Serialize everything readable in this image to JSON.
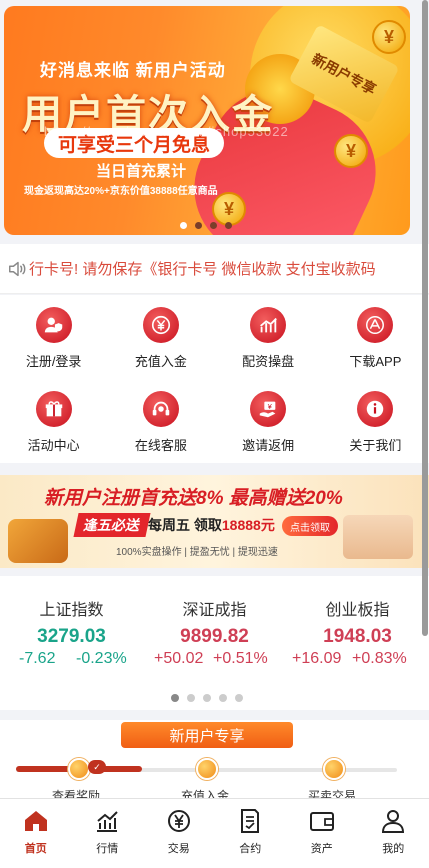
{
  "banner": {
    "subtitle": "好消息来临  新用户活动",
    "title": "用户首次入金",
    "pill": "可享受三个月免息",
    "first_recharge": "当日首充累计",
    "note": "现金返现高达20%+京东价值38888任意商品",
    "tag": "新用户专享",
    "coin_symbol": "¥",
    "watermark": "https://www.huzhan.com/ishop53022",
    "dot_count": 4,
    "active_dot": 0
  },
  "notice": {
    "text": "行卡号! 请勿保存《银行卡号  微信收款  支付宝收款码"
  },
  "menu": {
    "items": [
      {
        "label": "注册/登录",
        "icon": "user-shield-icon"
      },
      {
        "label": "充值入金",
        "icon": "yen-icon"
      },
      {
        "label": "配资操盘",
        "icon": "bar-chart-icon"
      },
      {
        "label": "下载APP",
        "icon": "app-store-icon"
      },
      {
        "label": "活动中心",
        "icon": "gift-icon"
      },
      {
        "label": "在线客服",
        "icon": "headset-icon"
      },
      {
        "label": "邀请返佣",
        "icon": "money-hand-icon"
      },
      {
        "label": "关于我们",
        "icon": "info-icon"
      }
    ]
  },
  "promo": {
    "headline": "新用户注册首充送8% 最高赠送20%",
    "badge": "逢五必送",
    "weekly": "每周五 领取",
    "amount": "18888元",
    "cta": "点击领取",
    "footer": "100%实盘操作  |  提盈无忧  |  提现迅速"
  },
  "indices": [
    {
      "name": "上证指数",
      "price": "3279.03",
      "change": "-7.62",
      "percent": "-0.23%",
      "trend": "down"
    },
    {
      "name": "深证成指",
      "price": "9899.82",
      "change": "+50.02",
      "percent": "+0.51%",
      "trend": "up"
    },
    {
      "name": "创业板指",
      "price": "1948.03",
      "change": "+16.09",
      "percent": "+0.83%",
      "trend": "up"
    }
  ],
  "index_dots": {
    "count": 5,
    "active": 0
  },
  "new_user": {
    "title": "新用户专享",
    "steps": [
      "查看奖励",
      "充值入金",
      "买卖交易"
    ],
    "progress": 0.33
  },
  "nav": {
    "items": [
      {
        "label": "首页",
        "icon": "home-icon",
        "active": true
      },
      {
        "label": "行情",
        "icon": "market-chart-icon",
        "active": false
      },
      {
        "label": "交易",
        "icon": "trade-yen-icon",
        "active": false
      },
      {
        "label": "合约",
        "icon": "contract-icon",
        "active": false
      },
      {
        "label": "资产",
        "icon": "wallet-icon",
        "active": false
      },
      {
        "label": "我的",
        "icon": "profile-icon",
        "active": false
      }
    ]
  },
  "colors": {
    "accent": "#c0321f",
    "up": "#cf3f55",
    "down": "#1aa48a",
    "notice": "#d94b3c"
  }
}
